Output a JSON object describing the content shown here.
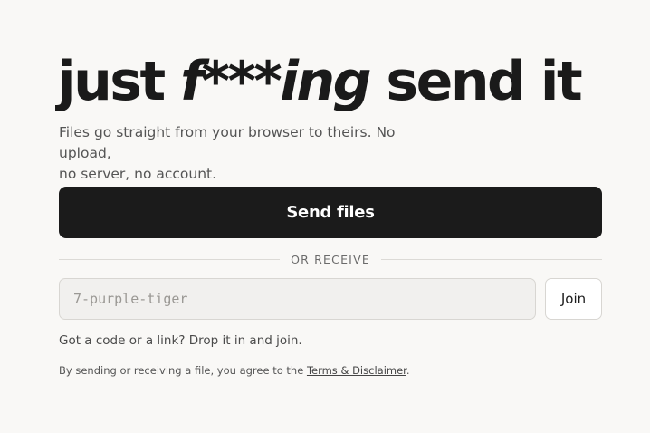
{
  "hero": {
    "headline_start": "just ",
    "headline_emphasis": "f***ing",
    "headline_end": " send it",
    "tagline_line1": "Files go straight from your browser to theirs. No upload,",
    "tagline_line2": "no server, no account."
  },
  "send": {
    "button_label": "Send files"
  },
  "receive": {
    "divider_label": "OR RECEIVE",
    "code_placeholder": "7-purple-tiger",
    "code_value": "",
    "join_label": "Join",
    "hint": "Got a code or a link? Drop it in and join."
  },
  "legal": {
    "prefix": "By sending or receiving a file, you agree to the ",
    "link_label": "Terms & Disclaimer",
    "suffix": "."
  }
}
